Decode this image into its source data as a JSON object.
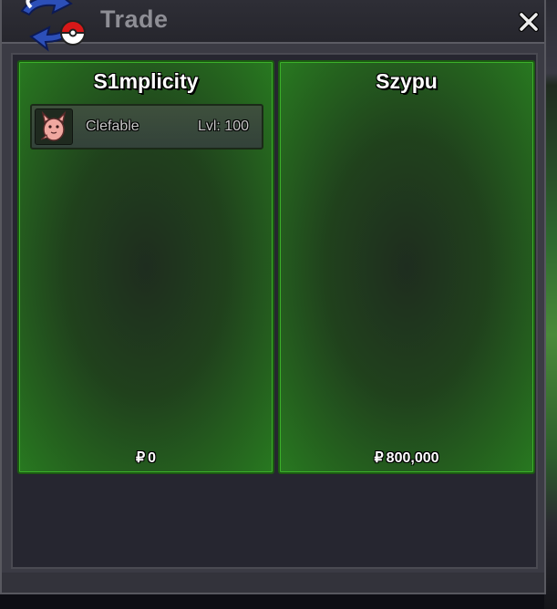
{
  "window": {
    "title": "Trade",
    "close_label": "✕"
  },
  "trade": {
    "left": {
      "player_name": "S1mplicity",
      "items": [
        {
          "name": "Clefable",
          "level": "Lvl: 100",
          "icon": "clefable-sprite-icon"
        }
      ],
      "currency_symbol": "₽",
      "money": "0"
    },
    "right": {
      "player_name": "Szypu",
      "items": [],
      "currency_symbol": "₽",
      "money": "800,000"
    }
  },
  "colors": {
    "panel_green": "#2f8a22",
    "window_bg": "#3b3b44",
    "title_text": "#8e8e95"
  }
}
